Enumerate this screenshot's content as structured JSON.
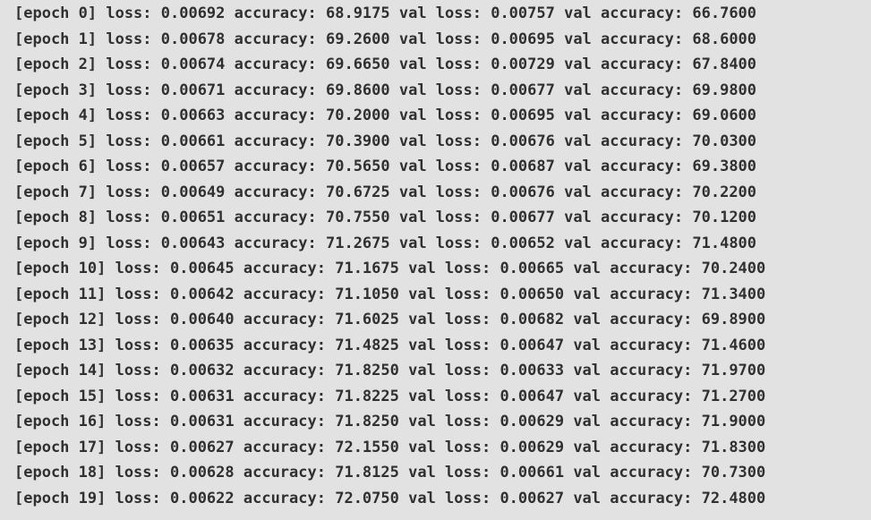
{
  "console": {
    "lines": [
      "[epoch 0] loss: 0.00692 accuracy: 68.9175 val loss: 0.00757 val accuracy: 66.7600",
      "[epoch 1] loss: 0.00678 accuracy: 69.2600 val loss: 0.00695 val accuracy: 68.6000",
      "[epoch 2] loss: 0.00674 accuracy: 69.6650 val loss: 0.00729 val accuracy: 67.8400",
      "[epoch 3] loss: 0.00671 accuracy: 69.8600 val loss: 0.00677 val accuracy: 69.9800",
      "[epoch 4] loss: 0.00663 accuracy: 70.2000 val loss: 0.00695 val accuracy: 69.0600",
      "[epoch 5] loss: 0.00661 accuracy: 70.3900 val loss: 0.00676 val accuracy: 70.0300",
      "[epoch 6] loss: 0.00657 accuracy: 70.5650 val loss: 0.00687 val accuracy: 69.3800",
      "[epoch 7] loss: 0.00649 accuracy: 70.6725 val loss: 0.00676 val accuracy: 70.2200",
      "[epoch 8] loss: 0.00651 accuracy: 70.7550 val loss: 0.00677 val accuracy: 70.1200",
      "[epoch 9] loss: 0.00643 accuracy: 71.2675 val loss: 0.00652 val accuracy: 71.4800",
      "[epoch 10] loss: 0.00645 accuracy: 71.1675 val loss: 0.00665 val accuracy: 70.2400",
      "[epoch 11] loss: 0.00642 accuracy: 71.1050 val loss: 0.00650 val accuracy: 71.3400",
      "[epoch 12] loss: 0.00640 accuracy: 71.6025 val loss: 0.00682 val accuracy: 69.8900",
      "[epoch 13] loss: 0.00635 accuracy: 71.4825 val loss: 0.00647 val accuracy: 71.4600",
      "[epoch 14] loss: 0.00632 accuracy: 71.8250 val loss: 0.00633 val accuracy: 71.9700",
      "[epoch 15] loss: 0.00631 accuracy: 71.8225 val loss: 0.00647 val accuracy: 71.2700",
      "[epoch 16] loss: 0.00631 accuracy: 71.8250 val loss: 0.00629 val accuracy: 71.9000",
      "[epoch 17] loss: 0.00627 accuracy: 72.1550 val loss: 0.00629 val accuracy: 71.8300",
      "[epoch 18] loss: 0.00628 accuracy: 71.8125 val loss: 0.00661 val accuracy: 70.7300",
      "[epoch 19] loss: 0.00622 accuracy: 72.0750 val loss: 0.00627 val accuracy: 72.4800"
    ]
  },
  "colors": {
    "background": "#e2e2e2",
    "text": "#303030"
  }
}
